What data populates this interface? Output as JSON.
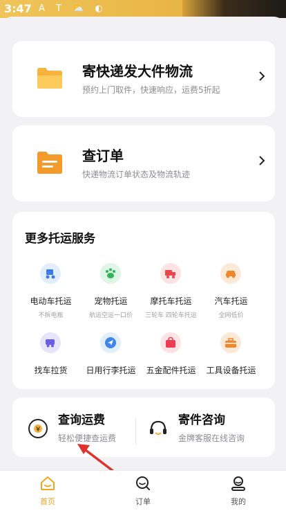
{
  "status_bar": {
    "time": "3:47",
    "icons": "A T ⛅ ◐"
  },
  "service_cards": [
    {
      "title": "寄快递发大件物流",
      "subtitle": "预约上门取件，快速响应，运费5折起"
    },
    {
      "title": "查订单",
      "subtitle": "快递物流订单状态及物流轨迹"
    }
  ],
  "more_services": {
    "heading": "更多托运服务",
    "items": [
      {
        "label": "电动车托运",
        "sublabel": "不拆电瓶",
        "color": "#e3eefc",
        "icon": "scooter-icon"
      },
      {
        "label": "宠物托运",
        "sublabel": "航运空运一口价",
        "color": "#dff5e6",
        "icon": "paw-icon"
      },
      {
        "label": "摩托车托运",
        "sublabel": "三轮车 四轮车托运",
        "color": "#fde3e3",
        "icon": "truck-icon"
      },
      {
        "label": "汽车托运",
        "sublabel": "全网低价",
        "color": "#fde9d8",
        "icon": "car-icon"
      },
      {
        "label": "找车拉货",
        "sublabel": "",
        "color": "#e6e5fb",
        "icon": "van-icon"
      },
      {
        "label": "日用行李托运",
        "sublabel": "",
        "color": "#e1eefc",
        "icon": "send-icon"
      },
      {
        "label": "五金配件托运",
        "sublabel": "",
        "color": "#fde3e6",
        "icon": "bag-icon"
      },
      {
        "label": "工具设备托运",
        "sublabel": "",
        "color": "#fde9d8",
        "icon": "toolbox-icon"
      }
    ]
  },
  "bottom": {
    "freight": {
      "title": "查询运费",
      "subtitle": "轻松便捷查运费"
    },
    "consult": {
      "title": "寄件咨询",
      "subtitle": "金牌客服在线咨询"
    }
  },
  "tabs": [
    {
      "label": "首页",
      "active": true
    },
    {
      "label": "订单",
      "active": false
    },
    {
      "label": "我的",
      "active": false
    }
  ],
  "colors": {
    "accent": "#f2a51a",
    "arrow": "#e0322c"
  }
}
